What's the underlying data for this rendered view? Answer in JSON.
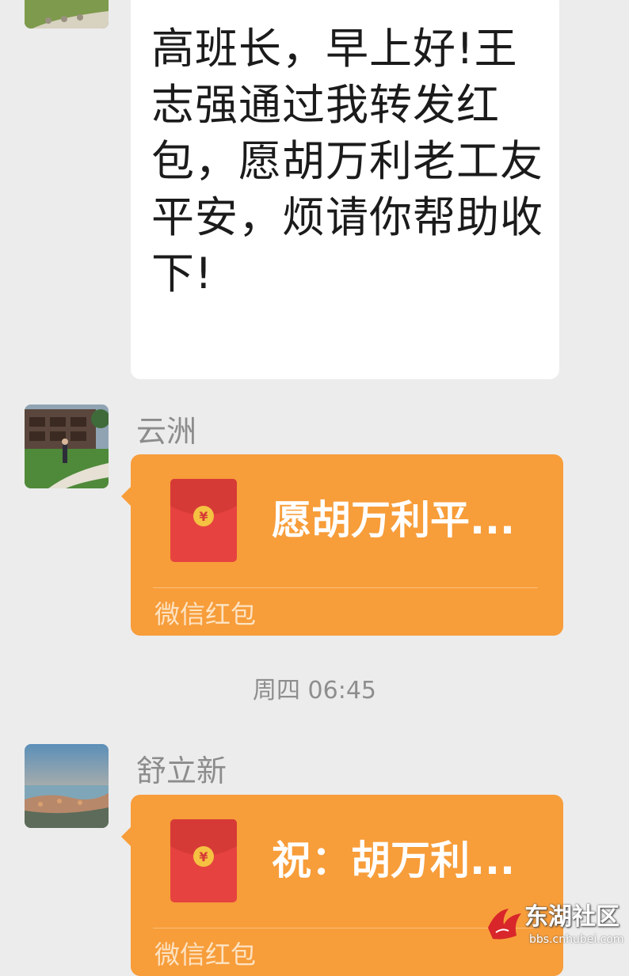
{
  "chat": {
    "messages": [
      {
        "type": "text",
        "text": "高班长，早上好!王志强通过我转发红包，愿胡万利老工友平安，烦请你帮助收下!"
      },
      {
        "type": "red_packet",
        "sender": "云洲",
        "avatar": "photo-avatar-garden",
        "title": "愿胡万利平...",
        "label": "微信红包"
      },
      {
        "type": "timestamp",
        "text": "周四 06:45"
      },
      {
        "type": "red_packet",
        "sender": "舒立新",
        "avatar": "photo-avatar-seascape",
        "title": "祝：胡万利...",
        "label": "微信红包"
      }
    ]
  },
  "colors": {
    "background": "#ececec",
    "bubble": "#ffffff",
    "red_packet_card": "#f79d3a",
    "envelope": "#e64340",
    "coin": "#f5c242"
  },
  "icons": {
    "envelope": "red-envelope-icon",
    "coin": "yuan-coin-icon"
  },
  "watermark": {
    "name": "东湖社区",
    "url": "bbs.cnhubei.com"
  }
}
